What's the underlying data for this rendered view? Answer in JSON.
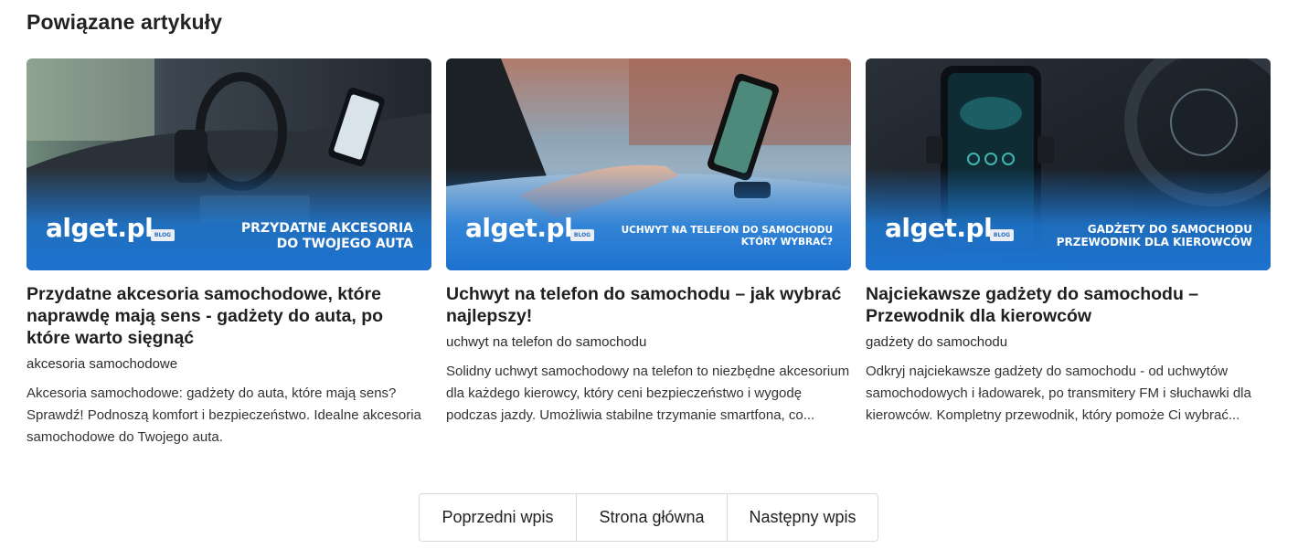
{
  "section_title": "Powiązane artykuły",
  "brand_name": "alget.pl",
  "brand_badge": "BLOG",
  "articles": [
    {
      "banner_lines": [
        "PRZYDATNE AKCESORIA",
        "DO TWOJEGO AUTA"
      ],
      "title": "Przydatne akcesoria samochodowe, które naprawdę mają sens - gadżety do auta, po które warto sięgnąć",
      "tag": "akcesoria samochodowe",
      "description": "Akcesoria samochodowe: gadżety do auta, które mają sens? Sprawdź! Podnoszą komfort i bezpieczeństwo. Idealne akcesoria samochodowe do Twojego auta."
    },
    {
      "banner_lines": [
        "UCHWYT NA TELEFON DO SAMOCHODU",
        "KTÓRY WYBRAĆ?"
      ],
      "title": "Uchwyt na telefon do samochodu – jak wybrać najlepszy!",
      "tag": "uchwyt na telefon do samochodu",
      "description": "Solidny uchwyt samochodowy na telefon to niezbędne akcesorium dla każdego kierowcy, który ceni bezpieczeństwo i wygodę podczas jazdy. Umożliwia stabilne trzymanie smartfona, co..."
    },
    {
      "banner_lines": [
        "GADŻETY DO SAMOCHODU",
        "PRZEWODNIK DLA KIEROWCÓW"
      ],
      "title": "Najciekawsze gadżety do samochodu – Przewodnik dla kierowców",
      "tag": "gadżety do samochodu",
      "description": "Odkryj najciekawsze gadżety do samochodu - od uchwytów samochodowych i ładowarek, po transmitery FM i słuchawki dla kierowców. Kompletny przewodnik, który pomoże Ci wybrać..."
    }
  ],
  "pagination": {
    "prev_label": "Poprzedni wpis",
    "home_label": "Strona główna",
    "next_label": "Następny wpis"
  },
  "colors": {
    "banner_blue": "#1f7ad6",
    "text_dark": "#1f1f1f",
    "border": "#d9d9d9"
  }
}
